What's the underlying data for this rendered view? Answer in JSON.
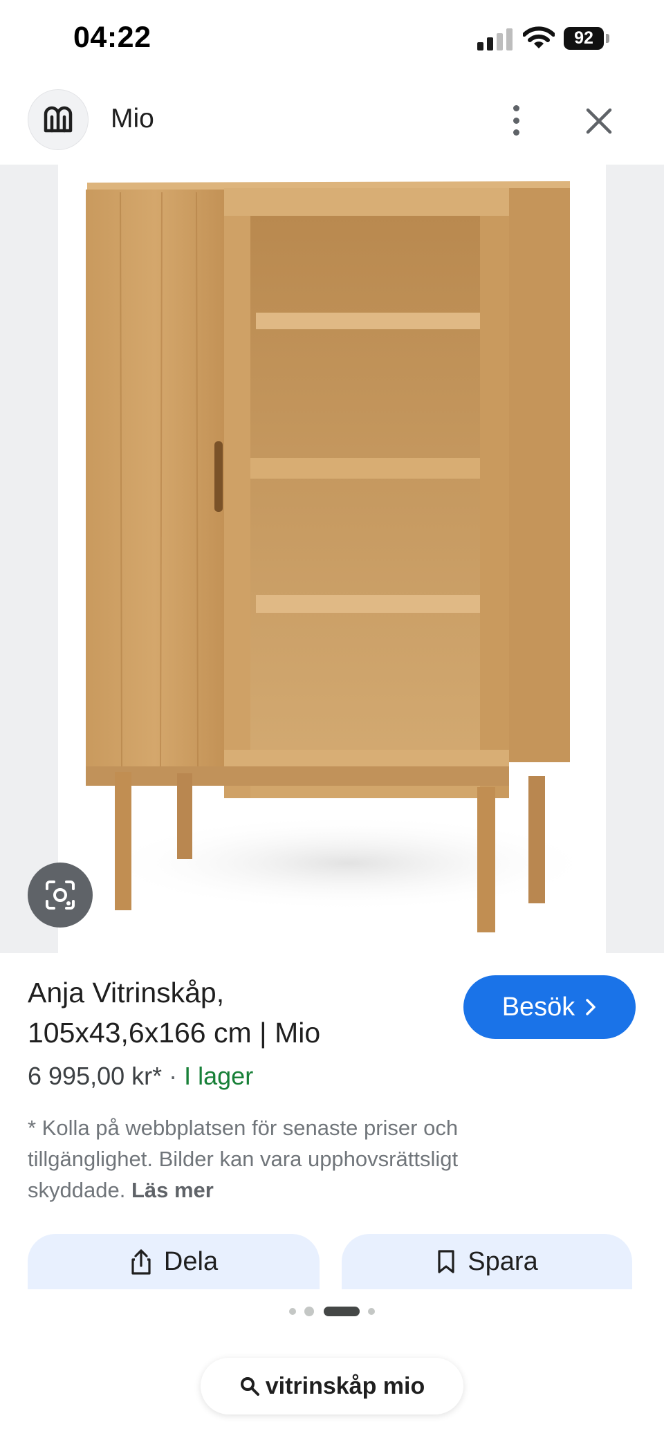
{
  "status_bar": {
    "time": "04:22",
    "battery": "92",
    "icons": [
      "signal-icon",
      "wifi-icon",
      "battery-icon"
    ]
  },
  "header": {
    "site_name": "Mio",
    "icons": [
      "mio-logo-icon",
      "more-vert-icon",
      "close-icon"
    ]
  },
  "image": {
    "subject": "oak glass-door display cabinet",
    "lens_icon": "google-lens-icon"
  },
  "product": {
    "title_line1": "Anja Vitrinskåp,",
    "title_line2": "105x43,6x166 cm | Mio",
    "price": "6 995,00 kr*",
    "separator": "·",
    "stock": "I lager",
    "stock_color": "#188038",
    "visit_label": "Besök",
    "visit_icon": "chevron-right-icon",
    "accent_color": "#1a73e8"
  },
  "disclaimer": {
    "text": "* Kolla på webbplatsen för senaste priser och tillgänglighet. Bilder kan vara upphovsrättsligt skyddade.",
    "link": "Läs mer"
  },
  "actions": {
    "share_label": "Dela",
    "share_icon": "share-icon",
    "save_label": "Spara",
    "save_icon": "bookmark-icon"
  },
  "pager": {
    "count": 4,
    "active_index": 2
  },
  "search_chip": {
    "label": "vitrinskåp mio",
    "icon": "search-icon"
  }
}
